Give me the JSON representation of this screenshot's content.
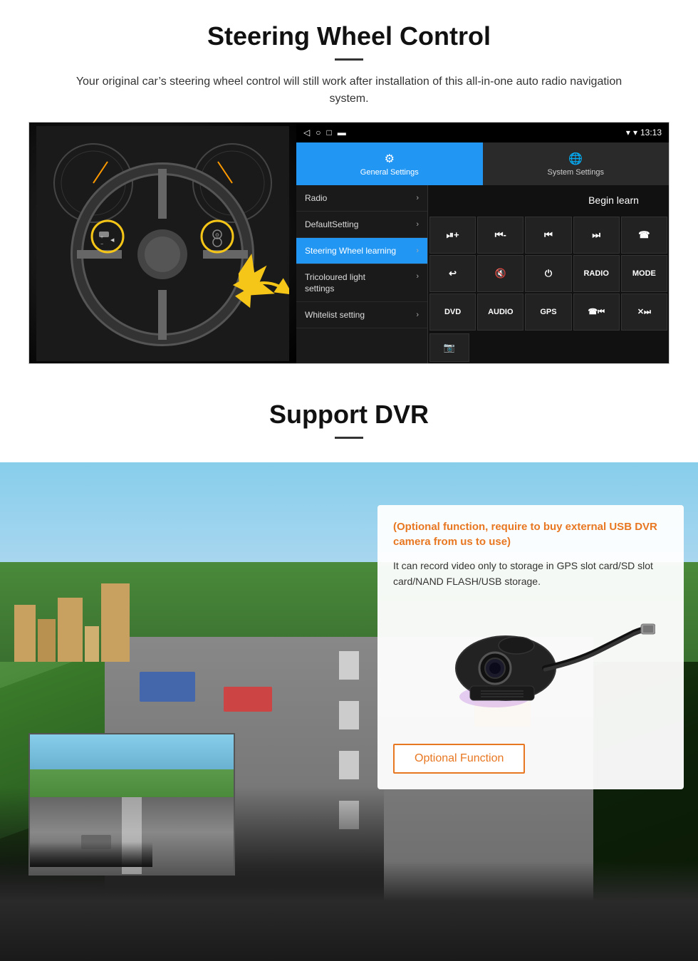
{
  "steering": {
    "title": "Steering Wheel Control",
    "subtitle": "Your original car’s steering wheel control will still work after installation of this all-in-one auto radio navigation system.",
    "status_time": "13:13",
    "tabs": [
      {
        "label": "General Settings",
        "icon": "⚙",
        "active": true
      },
      {
        "label": "System Settings",
        "icon": "🌐",
        "active": false
      }
    ],
    "menu_items": [
      {
        "label": "Radio",
        "active": false
      },
      {
        "label": "DefaultSetting",
        "active": false
      },
      {
        "label": "Steering Wheel learning",
        "active": true
      },
      {
        "label": "Tricoloured light settings",
        "active": false
      },
      {
        "label": "Whitelist setting",
        "active": false
      }
    ],
    "begin_learn": "Begin learn",
    "control_buttons": [
      "⏯+",
      "⏮-",
      "⏮⏮",
      "⏭⏭",
      "☎",
      "⤵",
      "⏸×",
      "⏻",
      "RADIO",
      "MODE",
      "DVD",
      "AUDIO",
      "GPS",
      "☎⏮⏮",
      "×⏭⏭"
    ]
  },
  "dvr": {
    "title": "Support DVR",
    "optional_text": "(Optional function, require to buy external USB DVR camera from us to use)",
    "description": "It can record video only to storage in GPS slot card/SD slot card/NAND FLASH/USB storage.",
    "optional_button": "Optional Function"
  }
}
